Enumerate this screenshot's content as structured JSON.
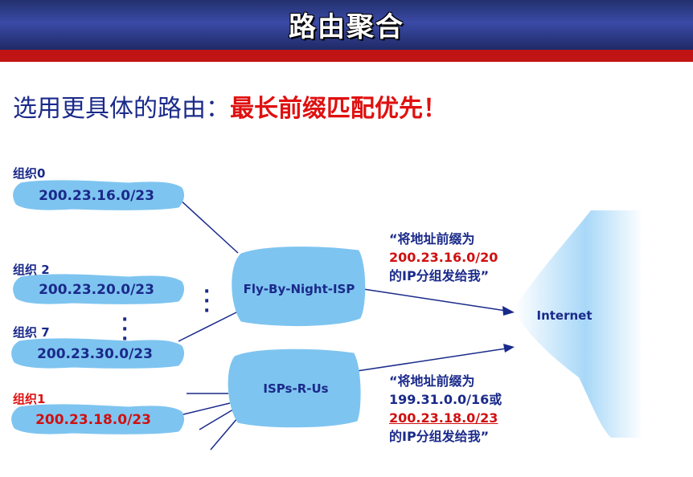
{
  "header": {
    "title": "路由聚合"
  },
  "headline": {
    "prefix": "选用更具体的路由：",
    "emphasis": "最长前缀匹配优先！"
  },
  "orgs": [
    {
      "label": "组织0",
      "prefix": "200.23.16.0/23"
    },
    {
      "label": "组织 2",
      "prefix": "200.23.20.0/23"
    },
    {
      "label": "组织 7",
      "prefix": "200.23.30.0/23"
    },
    {
      "label": "组织1",
      "prefix": "200.23.18.0/23"
    }
  ],
  "isps": {
    "fly": "Fly-By-Night-ISP",
    "rus": "ISPs-R-Us"
  },
  "internet": "Internet",
  "adv_fly": {
    "line1": "“将地址前缀为",
    "line2": "200.23.16.0/20",
    "line3": "的IP分组发给我”"
  },
  "adv_rus": {
    "line1": "“将地址前缀为",
    "line2": "199.31.0.0/16或",
    "line3": "200.23.18.0/23",
    "line4": "的IP分组发给我”"
  },
  "colors": {
    "cloud": "#7ec4f0",
    "blue_text": "#1a2a8a",
    "red_text": "#d01010",
    "header": "#2a3a8a",
    "header_bar": "#c01414"
  }
}
